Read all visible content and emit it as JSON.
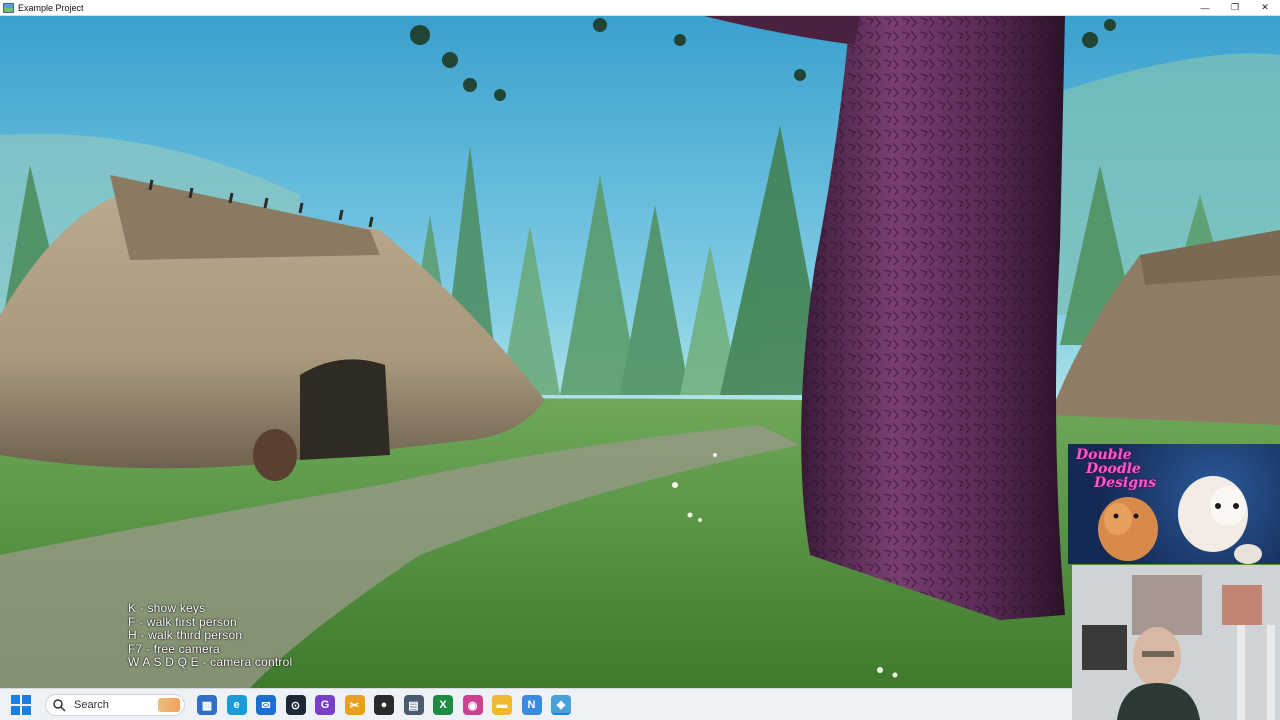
{
  "window": {
    "title": "Example Project",
    "minimize_glyph": "—",
    "restore_glyph": "❐",
    "close_glyph": "✕"
  },
  "viewport": {
    "help_lines": [
      "K - show keys",
      "F - walk first person",
      "H - walk third person",
      "F7 - free camera",
      "W A S D Q E - camera control"
    ]
  },
  "overlay": {
    "logo_lines": [
      "Double",
      "Doodle",
      "Designs"
    ]
  },
  "taskbar": {
    "search_placeholder": "Search",
    "icons": [
      {
        "name": "widget-app-icon",
        "color": "#2f6fc8",
        "glyph": "▦"
      },
      {
        "name": "edge-browser-icon",
        "color": "#1b9bd8",
        "glyph": "e"
      },
      {
        "name": "mail-icon",
        "color": "#1a6fd0",
        "glyph": "✉"
      },
      {
        "name": "steam-icon",
        "color": "#1b2838",
        "glyph": "⊙"
      },
      {
        "name": "game-launcher-icon",
        "color": "#7a3fc8",
        "glyph": "G"
      },
      {
        "name": "snipping-tool-icon",
        "color": "#e8a020",
        "glyph": "✂"
      },
      {
        "name": "recorder-icon",
        "color": "#2a2a2a",
        "glyph": "●"
      },
      {
        "name": "calculator-icon",
        "color": "#4a5a70",
        "glyph": "▤"
      },
      {
        "name": "spreadsheet-icon",
        "color": "#1e8a44",
        "glyph": "X"
      },
      {
        "name": "paint-icon",
        "color": "#d04090",
        "glyph": "◉"
      },
      {
        "name": "file-explorer-icon",
        "color": "#f0b830",
        "glyph": "▬"
      },
      {
        "name": "notepad-icon",
        "color": "#3a8ae0",
        "glyph": "N"
      },
      {
        "name": "engine-editor-icon",
        "color": "#4aa0d8",
        "glyph": "◆"
      }
    ]
  }
}
